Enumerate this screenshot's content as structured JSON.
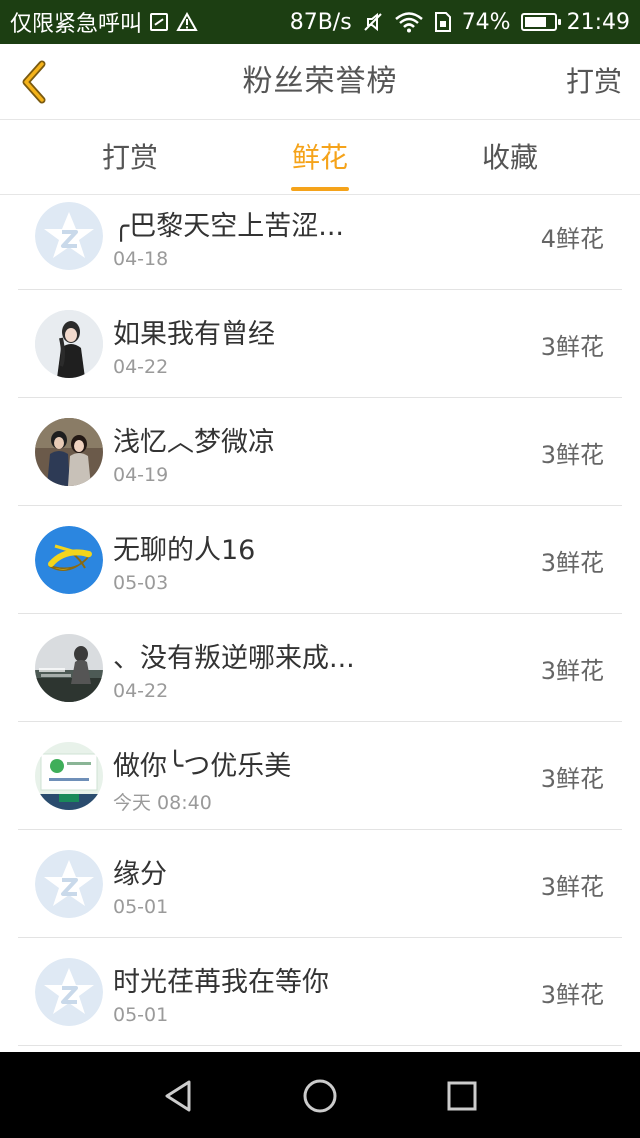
{
  "status_bar": {
    "carrier": "仅限紧急呼叫",
    "speed": "87B/s",
    "battery": "74%",
    "battery_level": 0.74,
    "time": "21:49",
    "icons": [
      "image-icon",
      "warning-icon",
      "mute-icon",
      "wifi-icon",
      "sim-icon",
      "battery-icon"
    ]
  },
  "header": {
    "title": "粉丝荣誉榜",
    "action": "打赏",
    "accent": "#f5a31a"
  },
  "tabs": [
    {
      "label": "打赏",
      "active": false
    },
    {
      "label": "鲜花",
      "active": true
    },
    {
      "label": "收藏",
      "active": false
    }
  ],
  "list": [
    {
      "name": "╭巴黎天空上苦涩...",
      "date": "04-18",
      "count": "4鲜花",
      "avatar": "default-qq"
    },
    {
      "name": "如果我有曾经",
      "date": "04-22",
      "count": "3鲜花",
      "avatar": "photo-girl"
    },
    {
      "name": "浅忆︿梦微凉",
      "date": "04-19",
      "count": "3鲜花",
      "avatar": "photo-couple"
    },
    {
      "name": "无聊的人16",
      "date": "05-03",
      "count": "3鲜花",
      "avatar": "banana-bow"
    },
    {
      "name": "、没有叛逆哪来成...",
      "date": "04-22",
      "count": "3鲜花",
      "avatar": "photo-scene"
    },
    {
      "name": "做你╰つ优乐美",
      "date": "今天 08:40",
      "count": "3鲜花",
      "avatar": "photo-card"
    },
    {
      "name": "缘分",
      "date": "05-01",
      "count": "3鲜花",
      "avatar": "default-qq"
    },
    {
      "name": "时光荏苒我在等你",
      "date": "05-01",
      "count": "3鲜花",
      "avatar": "default-qq"
    }
  ],
  "nav": [
    "back-triangle-icon",
    "home-circle-icon",
    "recents-square-icon"
  ]
}
